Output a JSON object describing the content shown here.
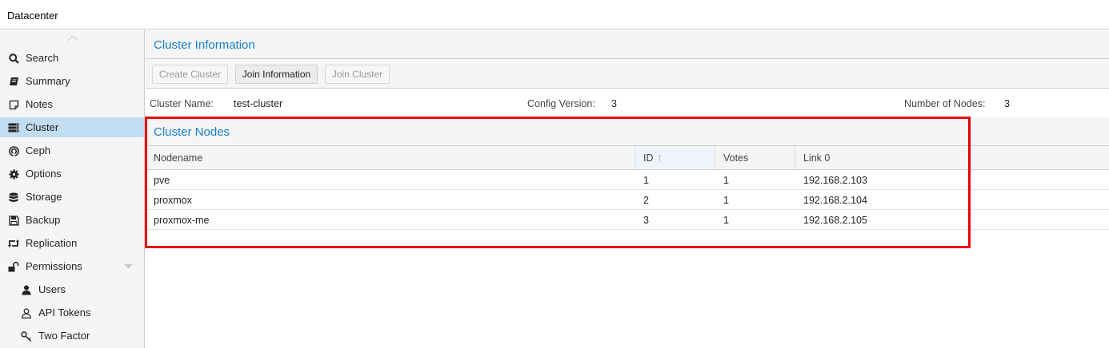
{
  "topbar": {
    "title": "Datacenter"
  },
  "sidebar": {
    "items": [
      {
        "label": "Search",
        "icon": "search-icon"
      },
      {
        "label": "Summary",
        "icon": "book-icon"
      },
      {
        "label": "Notes",
        "icon": "note-icon"
      },
      {
        "label": "Cluster",
        "icon": "server-icon",
        "active": true
      },
      {
        "label": "Ceph",
        "icon": "ceph-icon"
      },
      {
        "label": "Options",
        "icon": "gear-icon"
      },
      {
        "label": "Storage",
        "icon": "database-icon"
      },
      {
        "label": "Backup",
        "icon": "floppy-icon"
      },
      {
        "label": "Replication",
        "icon": "retweet-icon"
      },
      {
        "label": "Permissions",
        "icon": "unlock-icon"
      },
      {
        "label": "Users",
        "icon": "user-icon"
      },
      {
        "label": "API Tokens",
        "icon": "user-outline-icon"
      },
      {
        "label": "Two Factor",
        "icon": "key-icon"
      }
    ]
  },
  "cluster_info": {
    "title": "Cluster Information",
    "buttons": {
      "create": "Create Cluster",
      "join_info": "Join Information",
      "join": "Join Cluster"
    },
    "name_label": "Cluster Name:",
    "name_value": "test-cluster",
    "config_label": "Config Version:",
    "config_value": "3",
    "nodes_label": "Number of Nodes:",
    "nodes_value": "3"
  },
  "cluster_nodes": {
    "title": "Cluster Nodes",
    "columns": [
      "Nodename",
      "ID",
      "Votes",
      "Link 0"
    ],
    "sort_indicator": "↑",
    "rows": [
      [
        "pve",
        "1",
        "1",
        "192.168.2.103"
      ],
      [
        "proxmox",
        "2",
        "1",
        "192.168.2.104"
      ],
      [
        "proxmox-me",
        "3",
        "1",
        "192.168.2.105"
      ]
    ]
  },
  "colors": {
    "accent": "#157fcc",
    "active_nav": "#c2ddf2",
    "highlight_box": "#e8000b"
  }
}
